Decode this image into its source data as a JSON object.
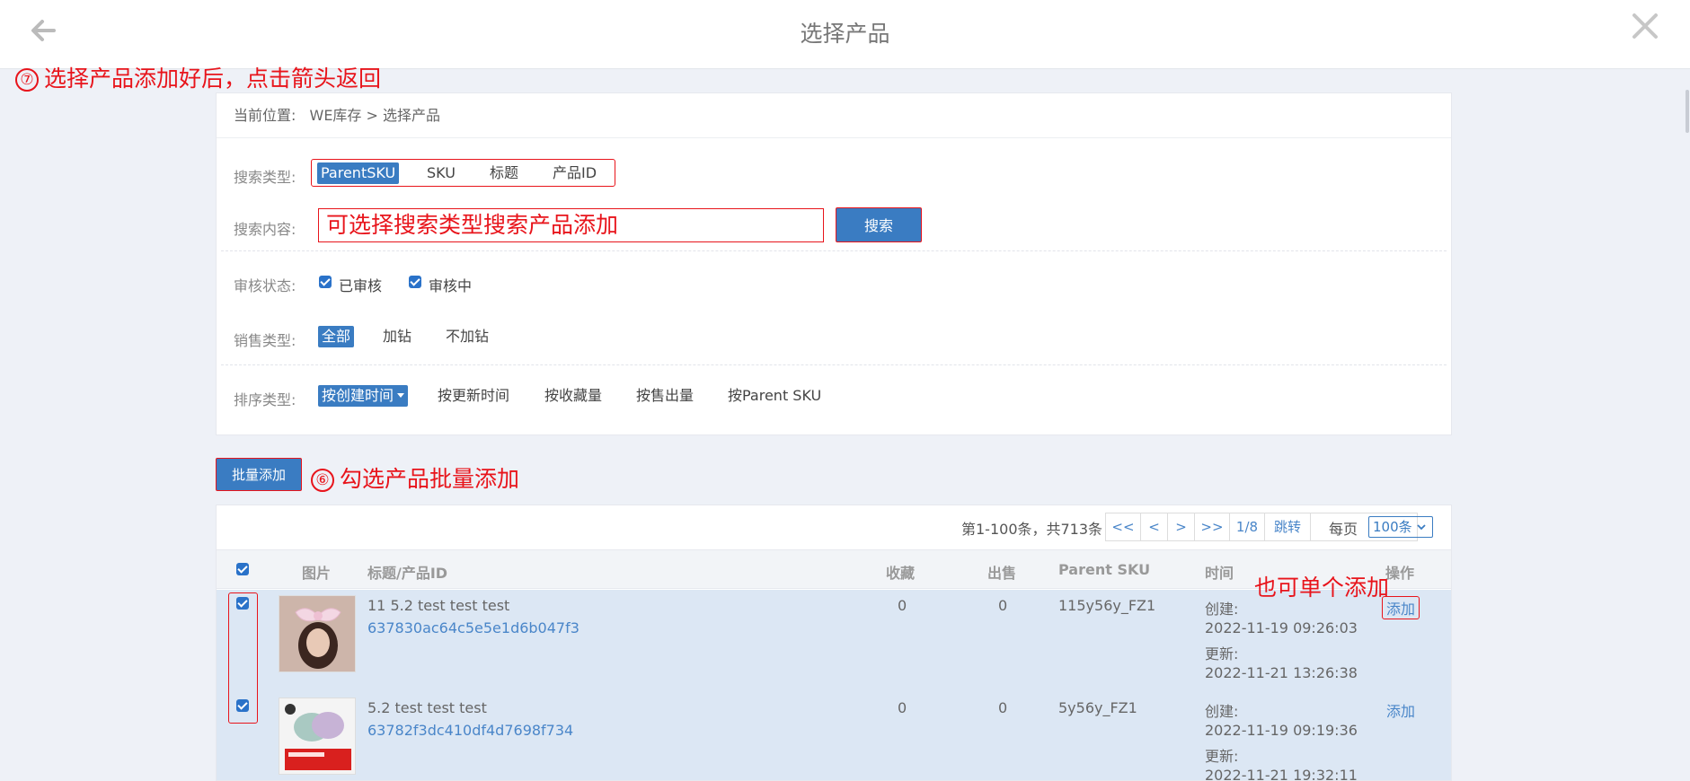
{
  "header": {
    "title": "选择产品"
  },
  "annotations": {
    "step7_num": "⑦",
    "step7_text": "选择产品添加好后，点击箭头返回",
    "step6_num": "⑥",
    "step6_text": "勾选产品批量添加",
    "single_text": "也可单个添加"
  },
  "breadcrumb": {
    "label": "当前位置:",
    "path": "WE库存 > 选择产品"
  },
  "search_type": {
    "label": "搜索类型:",
    "options": [
      "ParentSKU",
      "SKU",
      "标题",
      "产品ID"
    ],
    "selected": "ParentSKU"
  },
  "search_content": {
    "label": "搜索内容:",
    "value": "可选择搜索类型搜索产品添加",
    "button": "搜索"
  },
  "review_status": {
    "label": "审核状态:",
    "options": [
      "已审核",
      "审核中"
    ]
  },
  "sale_type": {
    "label": "销售类型:",
    "options": [
      "全部",
      "加钻",
      "不加钻"
    ],
    "selected": "全部"
  },
  "sort_type": {
    "label": "排序类型:",
    "options": [
      "按创建时间",
      "按更新时间",
      "按收藏量",
      "按售出量",
      "按Parent SKU"
    ],
    "selected": "按创建时间"
  },
  "batch_add_button": "批量添加",
  "pager": {
    "summary": "第1-100条，共713条",
    "first": "<<",
    "prev": "<",
    "next": ">",
    "last": ">>",
    "page": "1/8",
    "jump": "跳转",
    "per_page_label": "每页",
    "per_page_value": "100条"
  },
  "table": {
    "headers": [
      "图片",
      "标题/产品ID",
      "收藏",
      "出售",
      "Parent SKU",
      "时间",
      "操作"
    ],
    "rows": [
      {
        "title": "11 5.2 test test test",
        "product_id": "637830ac64c5e5e1d6b047f3",
        "favorites": "0",
        "sold": "0",
        "parent_sku": "115y56y_FZ1",
        "created_label": "创建:",
        "created": "2022-11-19 09:26:03",
        "updated_label": "更新:",
        "updated": "2022-11-21 13:26:38",
        "action": "添加"
      },
      {
        "title": "5.2 test test test",
        "product_id": "63782f3dc410df4d7698f734",
        "favorites": "0",
        "sold": "0",
        "parent_sku": "5y56y_FZ1",
        "created_label": "创建:",
        "created": "2022-11-19 09:19:36",
        "updated_label": "更新:",
        "updated": "2022-11-21 19:32:11",
        "action": "添加"
      }
    ]
  },
  "colors": {
    "primary": "#3a7cc2",
    "annotation_red": "#e8141b",
    "row_selected": "#dce7f4"
  }
}
